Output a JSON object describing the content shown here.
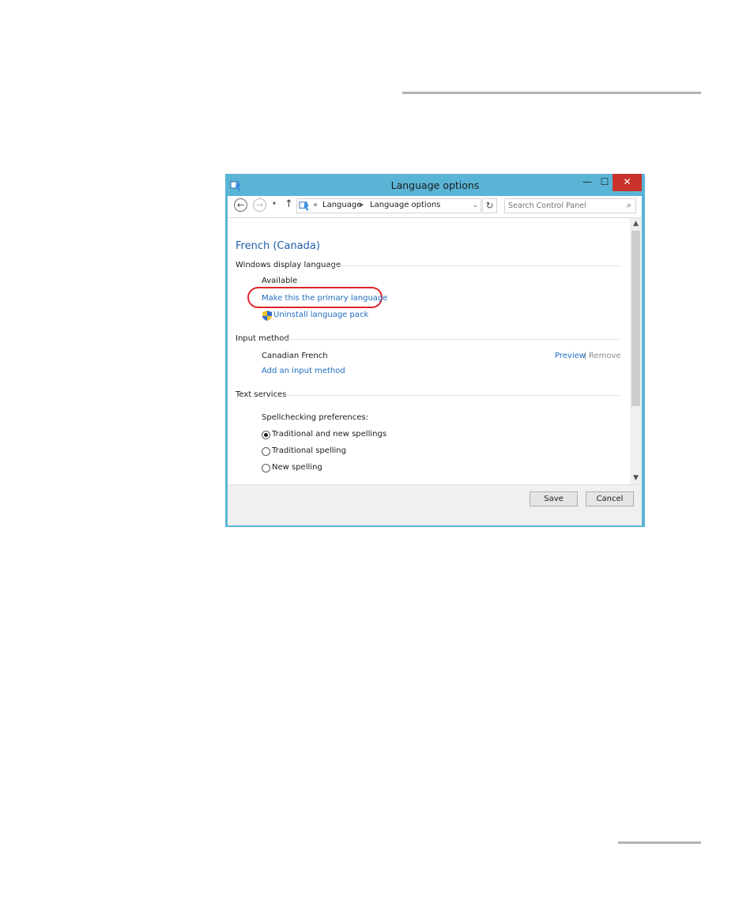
{
  "window": {
    "title": "Language options",
    "controls": {
      "minimize": "—",
      "maximize": "☐",
      "close": "✕"
    }
  },
  "addressbar": {
    "back": "←",
    "forward": "→",
    "dropdown": "▾",
    "up": "↑",
    "crumb_prefix": "«",
    "breadcrumb": [
      "Language",
      "Language options"
    ],
    "crumb_separator": "▶",
    "crumb_dropdown": "⌄",
    "refresh": "↻",
    "search_placeholder": "Search Control Panel",
    "search_icon": "⌕"
  },
  "content": {
    "heading": "French (Canada)",
    "display_section": {
      "label": "Windows display language",
      "status": "Available",
      "make_primary_link": "Make this the primary language",
      "uninstall_link": "Uninstall language pack"
    },
    "input_section": {
      "label": "Input method",
      "method_name": "Canadian French",
      "preview_link": "Preview",
      "separator": "|",
      "remove_link": "Remove",
      "add_link": "Add an input method"
    },
    "text_services_section": {
      "label": "Text services",
      "spellcheck_label": "Spellchecking preferences:",
      "options": [
        {
          "label": "Traditional and new spellings",
          "selected": true
        },
        {
          "label": "Traditional spelling",
          "selected": false
        },
        {
          "label": "New spelling",
          "selected": false
        }
      ]
    }
  },
  "footer": {
    "save_label": "Save",
    "cancel_label": "Cancel"
  },
  "colors": {
    "window_frame": "#5ab4d6",
    "close_button": "#c9332b",
    "link": "#1f6cc0",
    "heading": "#1f5ea8",
    "highlight": "#e0242b"
  },
  "icons": [
    "control-panel-icon",
    "search-icon",
    "shield-icon",
    "refresh-icon",
    "back-arrow-icon",
    "forward-arrow-icon",
    "up-arrow-icon"
  ]
}
